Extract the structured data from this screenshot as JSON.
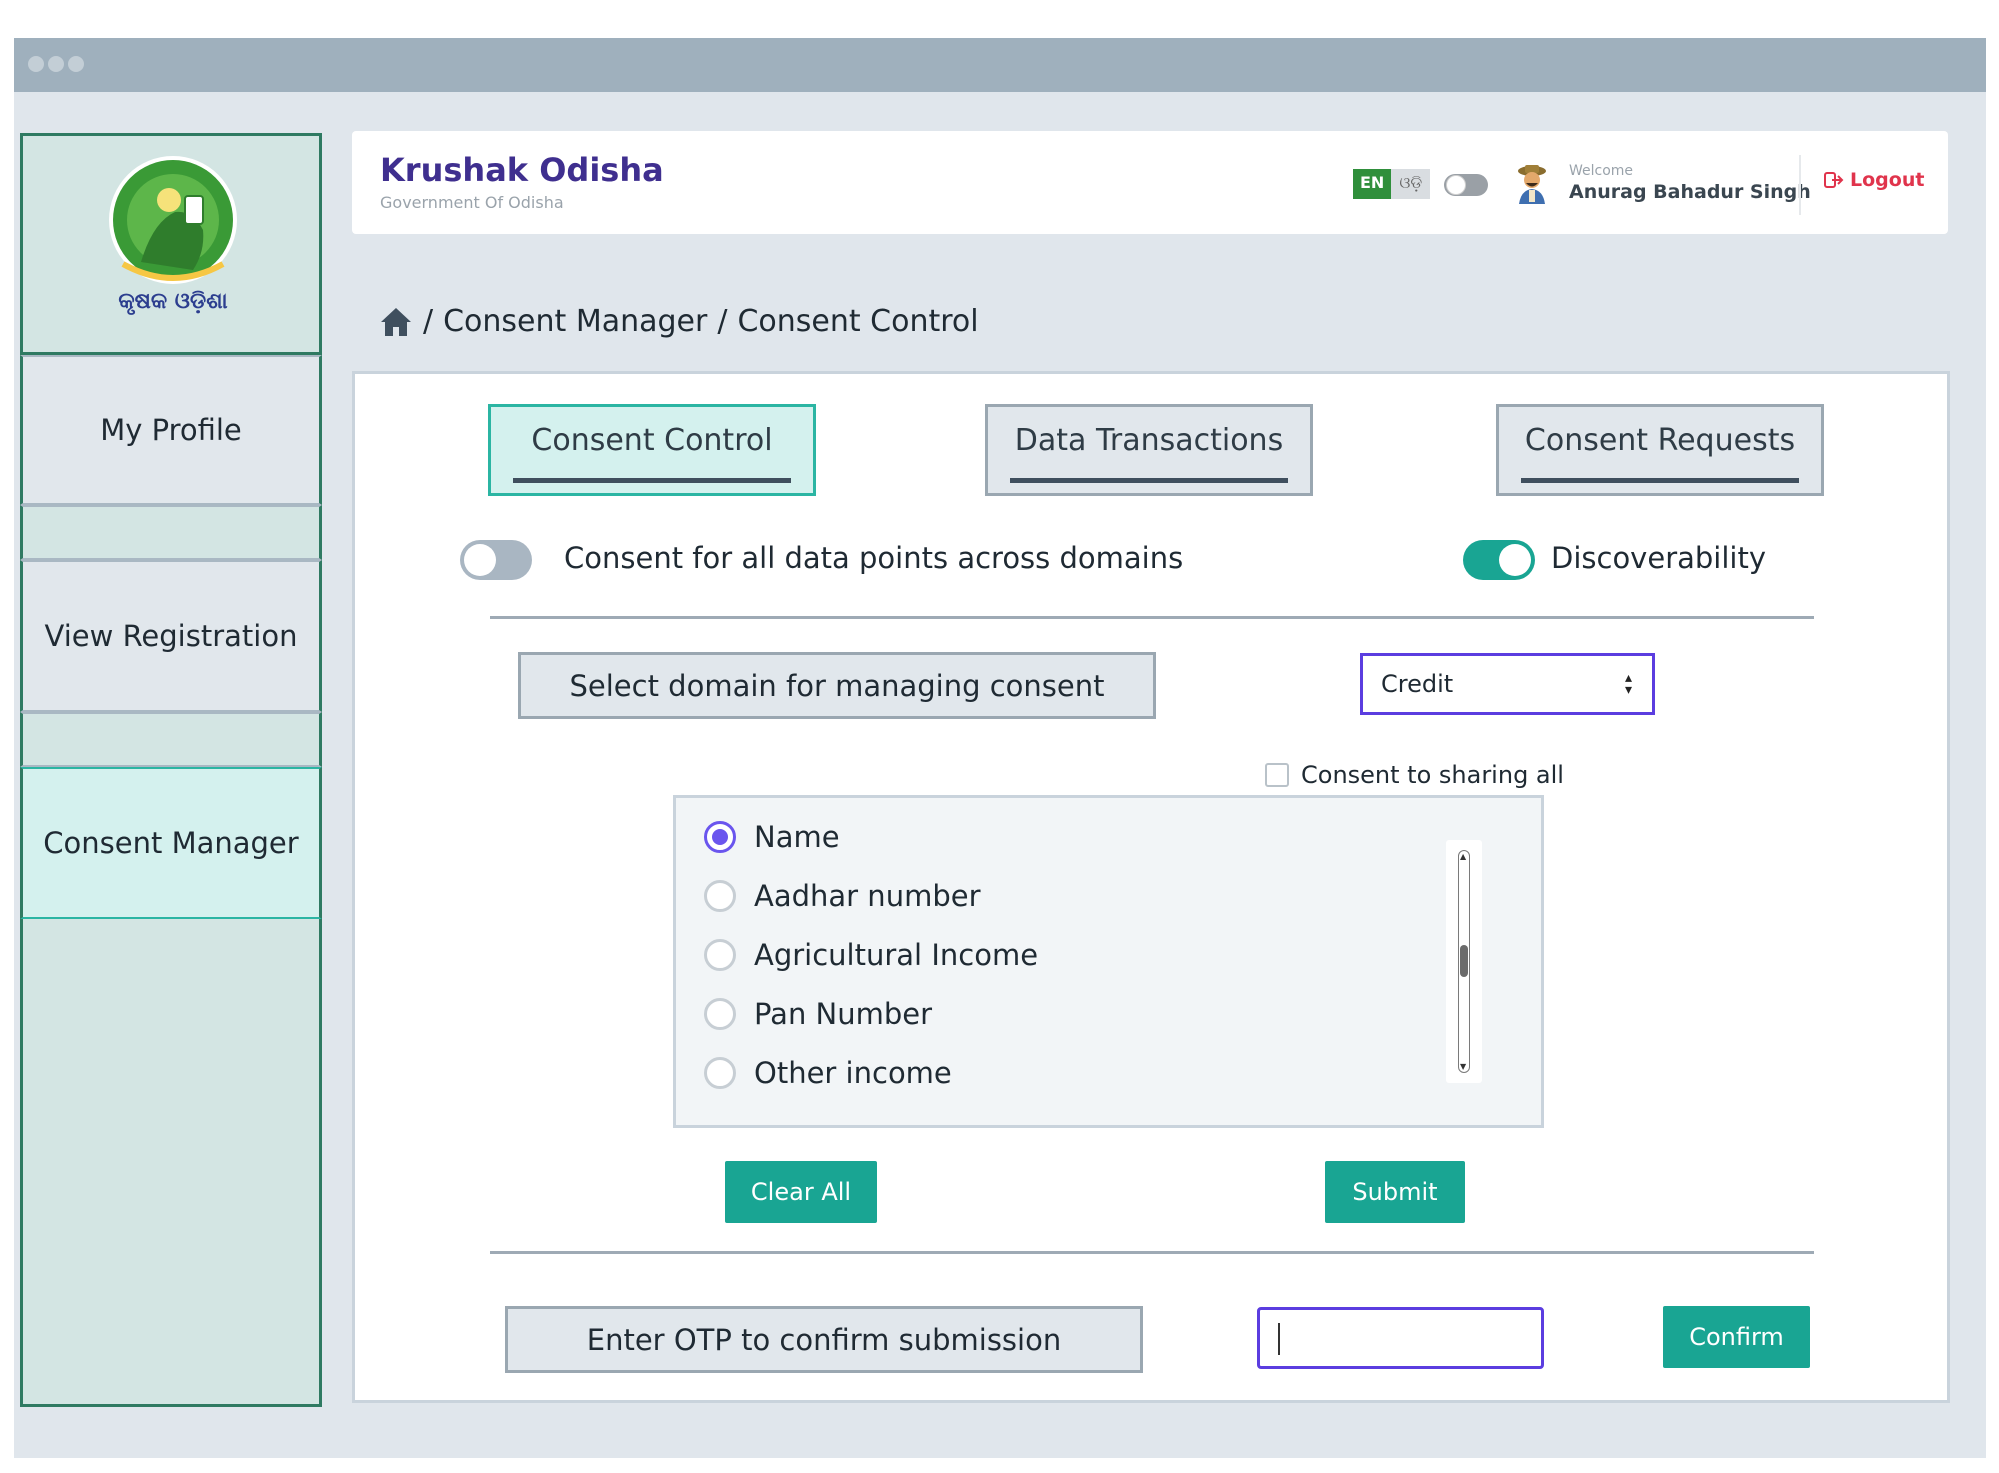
{
  "header": {
    "app_title": "Krushak Odisha",
    "app_subtitle": "Government Of Odisha",
    "lang_en": "EN",
    "lang_od": "ଓଡ଼ି",
    "welcome_label": "Welcome",
    "user_name": "Anurag Bahadur Singh",
    "logout_label": "Logout"
  },
  "logo": {
    "text": "କୃଷକ ଓଡ଼ିଶା"
  },
  "sidebar": {
    "items": [
      {
        "label": "My Profile",
        "active": false
      },
      {
        "label": "View Registration",
        "active": false
      },
      {
        "label": "Consent Manager",
        "active": true
      }
    ]
  },
  "breadcrumb": {
    "items": [
      "Consent Manager",
      "Consent Control"
    ]
  },
  "tabs": [
    {
      "label": "Consent Control",
      "active": true
    },
    {
      "label": "Data Transactions",
      "active": false
    },
    {
      "label": "Consent Requests",
      "active": false
    }
  ],
  "toggles": {
    "all_domains": {
      "label": "Consent for all data points across domains",
      "on": false
    },
    "discoverability": {
      "label": "Discoverability",
      "on": true
    }
  },
  "domain": {
    "label": "Select domain for managing consent",
    "selected": "Credit"
  },
  "consent_all_label": "Consent to sharing all",
  "data_points": [
    {
      "label": "Name",
      "selected": true
    },
    {
      "label": "Aadhar number",
      "selected": false
    },
    {
      "label": "Agricultural Income",
      "selected": false
    },
    {
      "label": "Pan Number",
      "selected": false
    },
    {
      "label": "Other income",
      "selected": false
    }
  ],
  "buttons": {
    "clear_all": "Clear All",
    "submit": "Submit",
    "confirm": "Confirm"
  },
  "otp": {
    "label": "Enter OTP to confirm submission",
    "value": ""
  },
  "colors": {
    "accent": "#19a593",
    "brand": "#3f2f8f",
    "focus": "#5b3de0",
    "logout": "#e0344c"
  }
}
